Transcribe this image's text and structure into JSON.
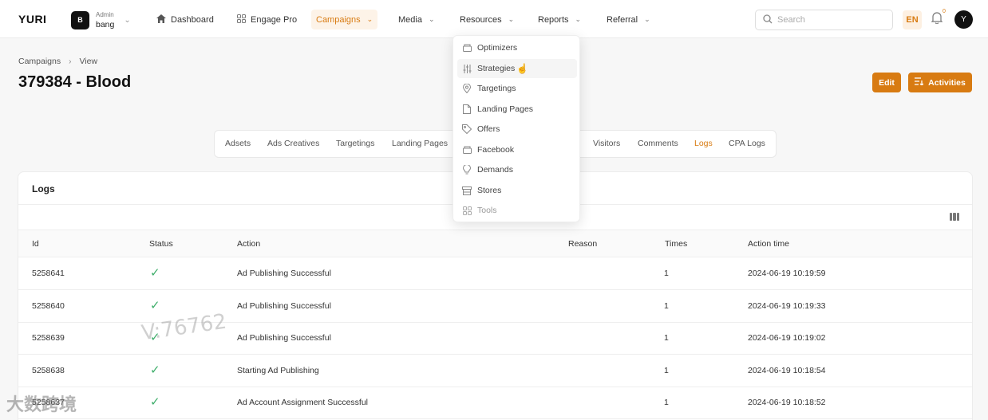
{
  "brand": "YURI",
  "account": {
    "badge": "B",
    "role": "Admin",
    "name": "bang"
  },
  "nav": [
    {
      "label": "Dashboard"
    },
    {
      "label": "Engage Pro"
    },
    {
      "label": "Campaigns"
    },
    {
      "label": "Media"
    },
    {
      "label": "Resources"
    },
    {
      "label": "Reports"
    },
    {
      "label": "Referral"
    }
  ],
  "search": {
    "placeholder": "Search"
  },
  "lang": "EN",
  "notifications": {
    "count": "0"
  },
  "user_avatar": "Y",
  "breadcrumb": {
    "root": "Campaigns",
    "current": "View"
  },
  "page_title": "379384 - Blood",
  "buttons": {
    "edit": "Edit",
    "activities": "Activities"
  },
  "tabs": [
    "Adsets",
    "Ads Creatives",
    "Targetings",
    "Landing Pages",
    "Visitors",
    "Comments",
    "Logs",
    "CPA Logs"
  ],
  "logs": {
    "title": "Logs",
    "columns": [
      "Id",
      "Status",
      "Action",
      "Reason",
      "Times",
      "Action time"
    ],
    "rows": [
      {
        "id": "5258641",
        "action": "Ad Publishing Successful",
        "reason": "",
        "times": "1",
        "time": "2024-06-19 10:19:59"
      },
      {
        "id": "5258640",
        "action": "Ad Publishing Successful",
        "reason": "",
        "times": "1",
        "time": "2024-06-19 10:19:33"
      },
      {
        "id": "5258639",
        "action": "Ad Publishing Successful",
        "reason": "",
        "times": "1",
        "time": "2024-06-19 10:19:02"
      },
      {
        "id": "5258638",
        "action": "Starting Ad Publishing",
        "reason": "",
        "times": "1",
        "time": "2024-06-19 10:18:54"
      },
      {
        "id": "5258637",
        "action": "Ad Account Assignment Successful",
        "reason": "",
        "times": "1",
        "time": "2024-06-19 10:18:52"
      }
    ]
  },
  "resources_menu": [
    {
      "label": "Optimizers",
      "icon": "box-icon"
    },
    {
      "label": "Strategies",
      "icon": "sliders-icon"
    },
    {
      "label": "Targetings",
      "icon": "pin-icon"
    },
    {
      "label": "Landing Pages",
      "icon": "file-icon"
    },
    {
      "label": "Offers",
      "icon": "tag-icon"
    },
    {
      "label": "Facebook",
      "icon": "box-icon"
    },
    {
      "label": "Demands",
      "icon": "bulb-icon"
    },
    {
      "label": "Stores",
      "icon": "store-icon"
    },
    {
      "label": "Tools",
      "icon": "grid-icon"
    }
  ],
  "watermarks": {
    "a": "V:76762",
    "b": "大数跨境"
  },
  "colors": {
    "accent": "#d87b12",
    "success": "#3fae6b"
  }
}
